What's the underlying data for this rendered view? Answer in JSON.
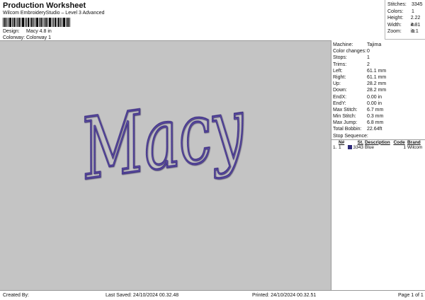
{
  "header": {
    "title": "Production Worksheet",
    "subtitle": "Wilcom EmbroideryStudio – Level 3 Advanced",
    "design_label": "Design:",
    "design_value": "Macy 4.8 in",
    "colorway_label": "Colorway:",
    "colorway_value": "Colorway 1"
  },
  "summary": {
    "stitches_label": "Stitches:",
    "stitches_value": "3345",
    "colors_label": "Colors:",
    "colors_value": "1",
    "height_label": "Height:",
    "height_value": "2.22 in",
    "width_label": "Width:",
    "width_value": "4.81 in",
    "zoom_label": "Zoom:",
    "zoom_value": "1:1"
  },
  "design_text": "Macy",
  "thread_color": "#3d2f82",
  "machine_info": [
    {
      "k": "Machine:",
      "v": "Tajima"
    },
    {
      "k": "Color changes:",
      "v": "0"
    },
    {
      "k": "Stops:",
      "v": "1"
    },
    {
      "k": "Trims:",
      "v": "2"
    },
    {
      "k": "Left:",
      "v": "61.1 mm"
    },
    {
      "k": "Right:",
      "v": "61.1 mm"
    },
    {
      "k": "Up:",
      "v": "28.2 mm"
    },
    {
      "k": "Down:",
      "v": "28.2 mm"
    },
    {
      "k": "EndX:",
      "v": "0.00 in"
    },
    {
      "k": "EndY:",
      "v": "0.00 in"
    },
    {
      "k": "Max Stitch:",
      "v": "6.7 mm"
    },
    {
      "k": "Min Stitch:",
      "v": "0.3 mm"
    },
    {
      "k": "Max Jump:",
      "v": "6.8 mm"
    },
    {
      "k": "Total Bobbin:",
      "v": "22.64ft"
    }
  ],
  "stop_sequence": {
    "label": "Stop Sequence:",
    "columns": [
      "N#",
      "St.",
      "Description",
      "Code",
      "Brand"
    ],
    "rows": [
      {
        "stop": "1.",
        "n": "1",
        "st": "3343",
        "description": "Blue",
        "code": "1",
        "brand": "Wilcom",
        "color": "#2e2a7a"
      }
    ]
  },
  "footer": {
    "created_by": "Created By:",
    "last_saved": "Last Saved: 24/10/2024 00.32.48",
    "printed": "Printed: 24/10/2024 00.32.51",
    "page": "Page 1 of 1"
  }
}
